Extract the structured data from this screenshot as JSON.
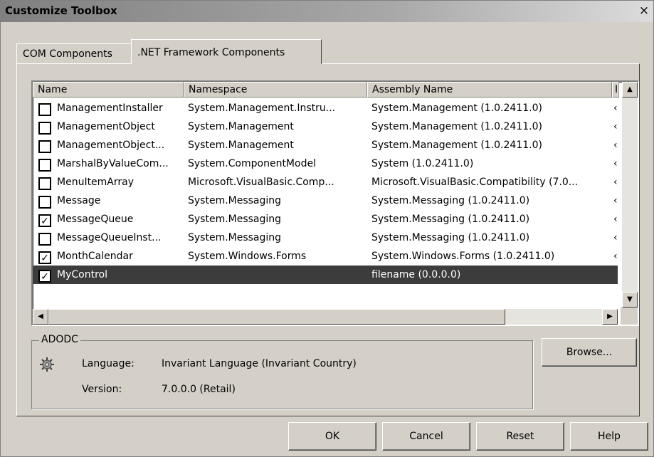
{
  "dialog": {
    "title": "Customize Toolbox",
    "close_glyph": "×"
  },
  "tabs": [
    {
      "label": "COM Components",
      "active": false
    },
    {
      "label": ".NET Framework Components",
      "active": true
    }
  ],
  "table": {
    "columns": [
      "Name",
      "Namespace",
      "Assembly Name",
      "I"
    ],
    "rows": [
      {
        "checked": false,
        "name": "ManagementInstaller",
        "namespace": "System.Management.Instru...",
        "assembly": "System.Management (1.0.2411.0)",
        "extra": "‹"
      },
      {
        "checked": false,
        "name": "ManagementObject",
        "namespace": "System.Management",
        "assembly": "System.Management (1.0.2411.0)",
        "extra": "‹"
      },
      {
        "checked": false,
        "name": "ManagementObject...",
        "namespace": "System.Management",
        "assembly": "System.Management (1.0.2411.0)",
        "extra": "‹"
      },
      {
        "checked": false,
        "name": "MarshalByValueCom...",
        "namespace": "System.ComponentModel",
        "assembly": "System (1.0.2411.0)",
        "extra": "‹"
      },
      {
        "checked": false,
        "name": "MenuItemArray",
        "namespace": "Microsoft.VisualBasic.Comp...",
        "assembly": "Microsoft.VisualBasic.Compatibility (7.0...",
        "extra": "‹"
      },
      {
        "checked": false,
        "name": "Message",
        "namespace": "System.Messaging",
        "assembly": "System.Messaging (1.0.2411.0)",
        "extra": "‹"
      },
      {
        "checked": true,
        "name": "MessageQueue",
        "namespace": "System.Messaging",
        "assembly": "System.Messaging (1.0.2411.0)",
        "extra": "‹"
      },
      {
        "checked": false,
        "name": "MessageQueueInst...",
        "namespace": "System.Messaging",
        "assembly": "System.Messaging (1.0.2411.0)",
        "extra": "‹"
      },
      {
        "checked": true,
        "name": "MonthCalendar",
        "namespace": "System.Windows.Forms",
        "assembly": "System.Windows.Forms (1.0.2411.0)",
        "extra": "‹"
      },
      {
        "checked": true,
        "name": "MyControl",
        "namespace": "",
        "assembly": "filename (0.0.0.0)",
        "extra": "",
        "selected": true
      }
    ],
    "check_glyph": "✓"
  },
  "scroll_icons": {
    "up": "▲",
    "down": "▼",
    "left": "◀",
    "right": "▶"
  },
  "details": {
    "group_label": "ADODC",
    "icon": "component-gear-icon",
    "language_label": "Language:",
    "language_value": "Invariant Language (Invariant Country)",
    "version_label": "Version:",
    "version_value": "7.0.0.0 (Retail)"
  },
  "buttons": {
    "browse": "Browse...",
    "ok": "OK",
    "cancel": "Cancel",
    "reset": "Reset",
    "help": "Help"
  }
}
